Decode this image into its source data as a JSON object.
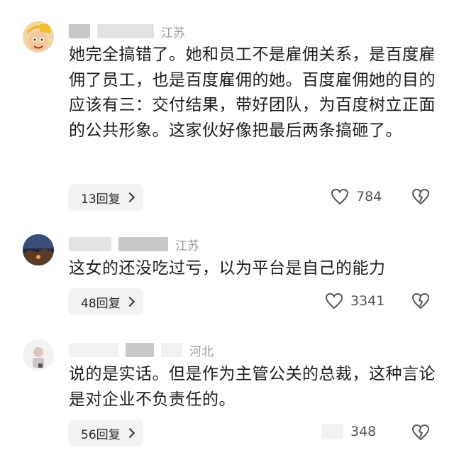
{
  "comments": [
    {
      "location": "江苏",
      "text": "她完全搞错了。她和员工不是雇佣关系，是百度雇佣了员工，也是百度雇佣的她。百度雇佣她的目的应该有三：交付结果，带好团队，为百度树立正面的公共形象。这家伙好像把最后两条搞砸了。",
      "reply_label": "13回复",
      "like_count": "784",
      "avatar": "cartoon-boy-yellow-hat"
    },
    {
      "location": "江苏",
      "text": "这女的还没吃过亏，以为平台是自己的能力",
      "reply_label": "48回复",
      "like_count": "3341",
      "avatar": "night-landscape"
    },
    {
      "location": "河北",
      "text": "说的是实话。但是作为主管公关的总裁，这种言论是对企业不负责任的。",
      "reply_label": "56回复",
      "like_count": "348",
      "avatar": "light-figure"
    }
  ],
  "icons": {
    "like": "heart-outline-icon",
    "dislike": "broken-heart-icon",
    "reply_arrow": "chevron-right-icon"
  },
  "colors": {
    "text": "#1c1c1c",
    "meta": "#9a9a9a",
    "button_bg": "#f3f3f3",
    "icon": "#555555"
  }
}
